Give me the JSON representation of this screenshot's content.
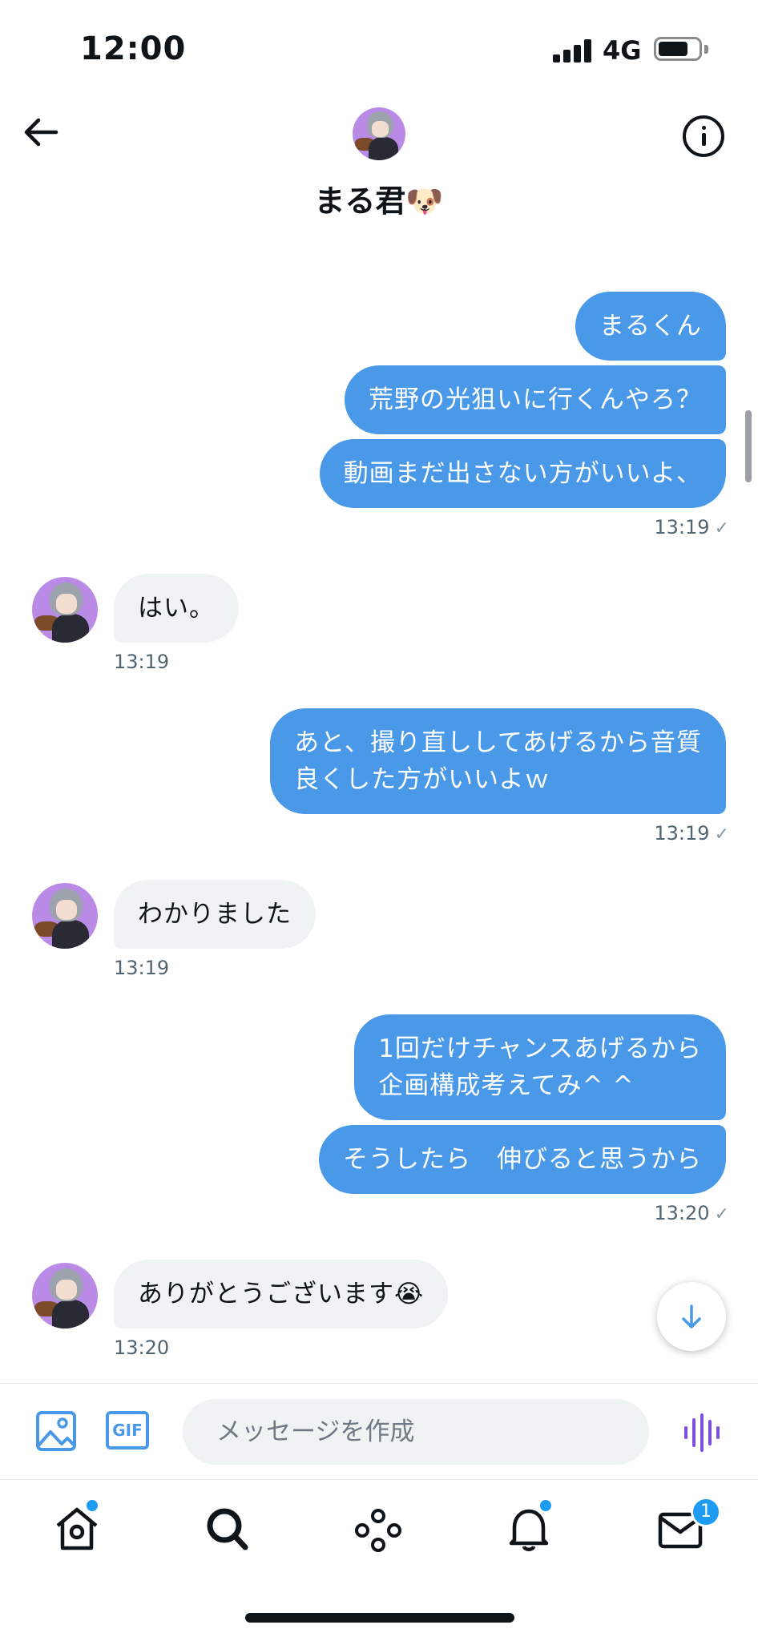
{
  "status_bar": {
    "time": "12:00",
    "network": "4G"
  },
  "header": {
    "title": "まる君🐶"
  },
  "messages": [
    {
      "text": "まるくん"
    },
    {
      "text": "荒野の光狙いに行くんやろ？"
    },
    {
      "text": "動画まだ出さない方がいいよ、"
    },
    {
      "time": "13:19"
    },
    {
      "text": "はい。",
      "time": "13:19"
    },
    {
      "line1": "あと、撮り直ししてあげるから音質",
      "line2": "良くした方がいいよｗ",
      "time": "13:19"
    },
    {
      "text": "わかりました",
      "time": "13:19"
    },
    {
      "line1": "1回だけチャンスあげるから",
      "line2": "企画構成考えてみ^ ^"
    },
    {
      "text": "そうしたら　伸びると思うから",
      "time": "13:20"
    },
    {
      "text": "ありがとうございます😭",
      "time": "13:20"
    }
  ],
  "composer": {
    "placeholder": "メッセージを作成",
    "gif_label": "GIF"
  },
  "tabbar": {
    "messages_badge": "1"
  },
  "colors": {
    "accent": "#4a99e9",
    "incoming_bubble": "#eff3f4",
    "voice": "#7b4fe0"
  },
  "icons": [
    "back-arrow-icon",
    "info-icon",
    "image-icon",
    "gif-icon",
    "voice-icon",
    "home-icon",
    "search-icon",
    "spaces-icon",
    "bell-icon",
    "mail-icon",
    "arrow-down-icon"
  ]
}
